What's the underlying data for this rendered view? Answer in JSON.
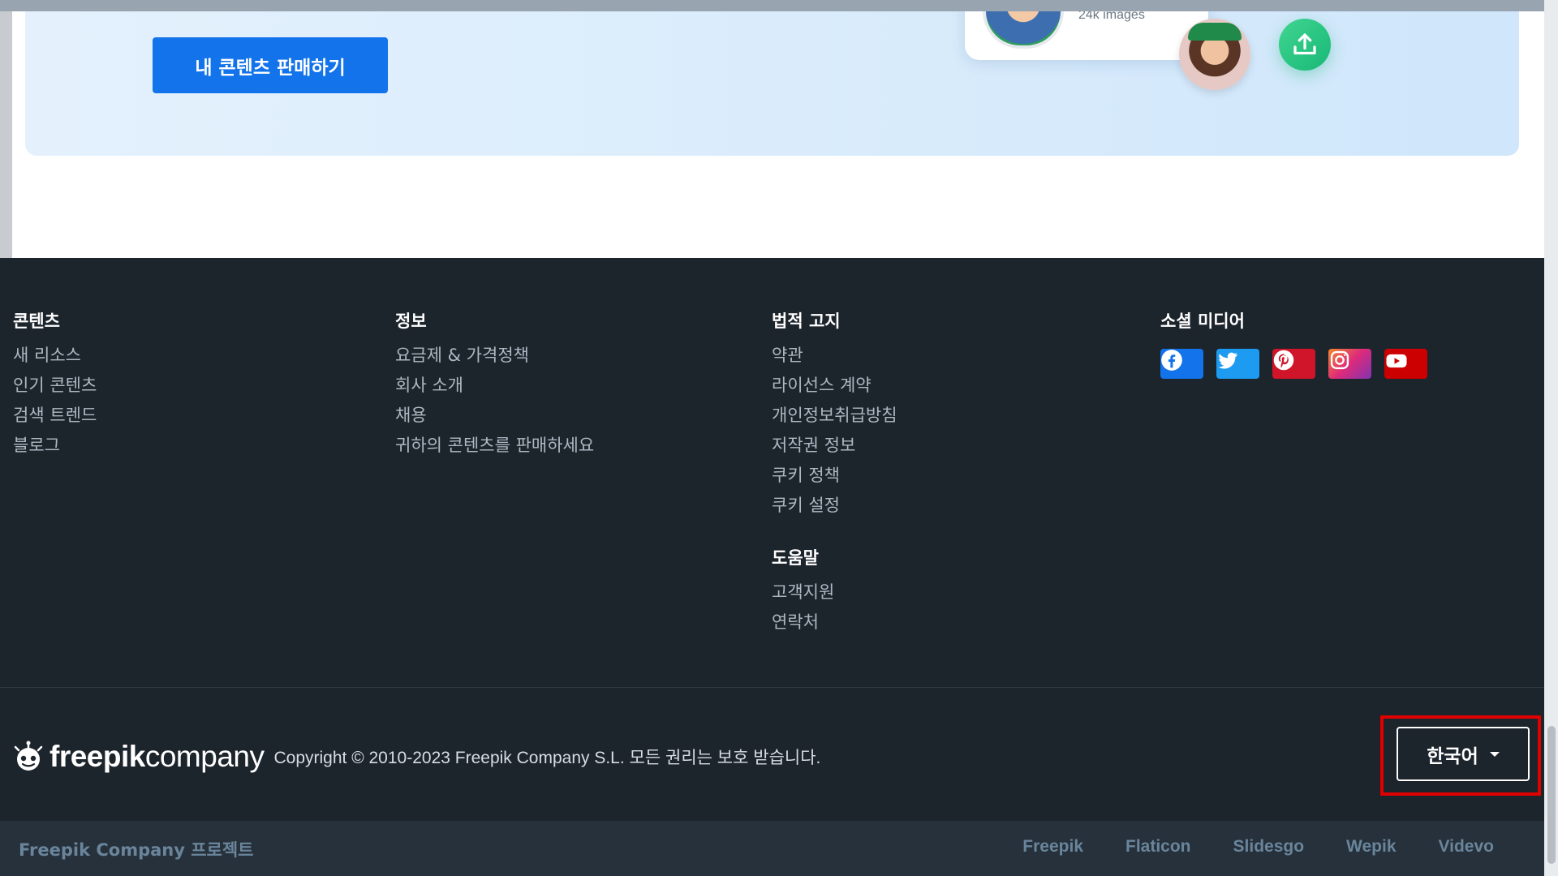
{
  "promo": {
    "sell_button": "내 콘텐츠 판매하기",
    "card_stat": "24k images"
  },
  "footer": {
    "columns": [
      {
        "heading": "콘텐츠",
        "links": [
          "새 리소스",
          "인기 콘텐츠",
          "검색 트렌드",
          "블로그"
        ]
      },
      {
        "heading": "정보",
        "links": [
          "요금제 & 가격정책",
          "회사 소개",
          "채용",
          "귀하의 콘텐츠를 판매하세요"
        ]
      },
      {
        "heading": "법적 고지",
        "links": [
          "약관",
          "라이선스 계약",
          "개인정보취급방침",
          "저작권 정보",
          "쿠키 정책",
          "쿠키 설정"
        ]
      },
      {
        "heading": "소셜 미디어"
      }
    ],
    "help": {
      "heading": "도움말",
      "links": [
        "고객지원",
        "연락처"
      ]
    },
    "social": [
      {
        "icon": "facebook-icon",
        "color": "#1273eb"
      },
      {
        "icon": "twitter-icon",
        "color": "#1d9bf0"
      },
      {
        "icon": "pinterest-icon",
        "color": "#d0142a"
      },
      {
        "icon": "instagram-icon",
        "color": "#e1306c"
      },
      {
        "icon": "youtube-icon",
        "color": "#cc0000"
      }
    ],
    "brand": {
      "bold": "freepik",
      "light": "company"
    },
    "copyright": "Copyright ©  2010-2023 Freepik Company S.L. 모든 권리는 보호 받습니다.",
    "language": "한국어",
    "projects_label": "Freepik Company 프로젝트",
    "projects": [
      "Freepik",
      "Flaticon",
      "Slidesgo",
      "Wepik",
      "Videvo"
    ]
  }
}
